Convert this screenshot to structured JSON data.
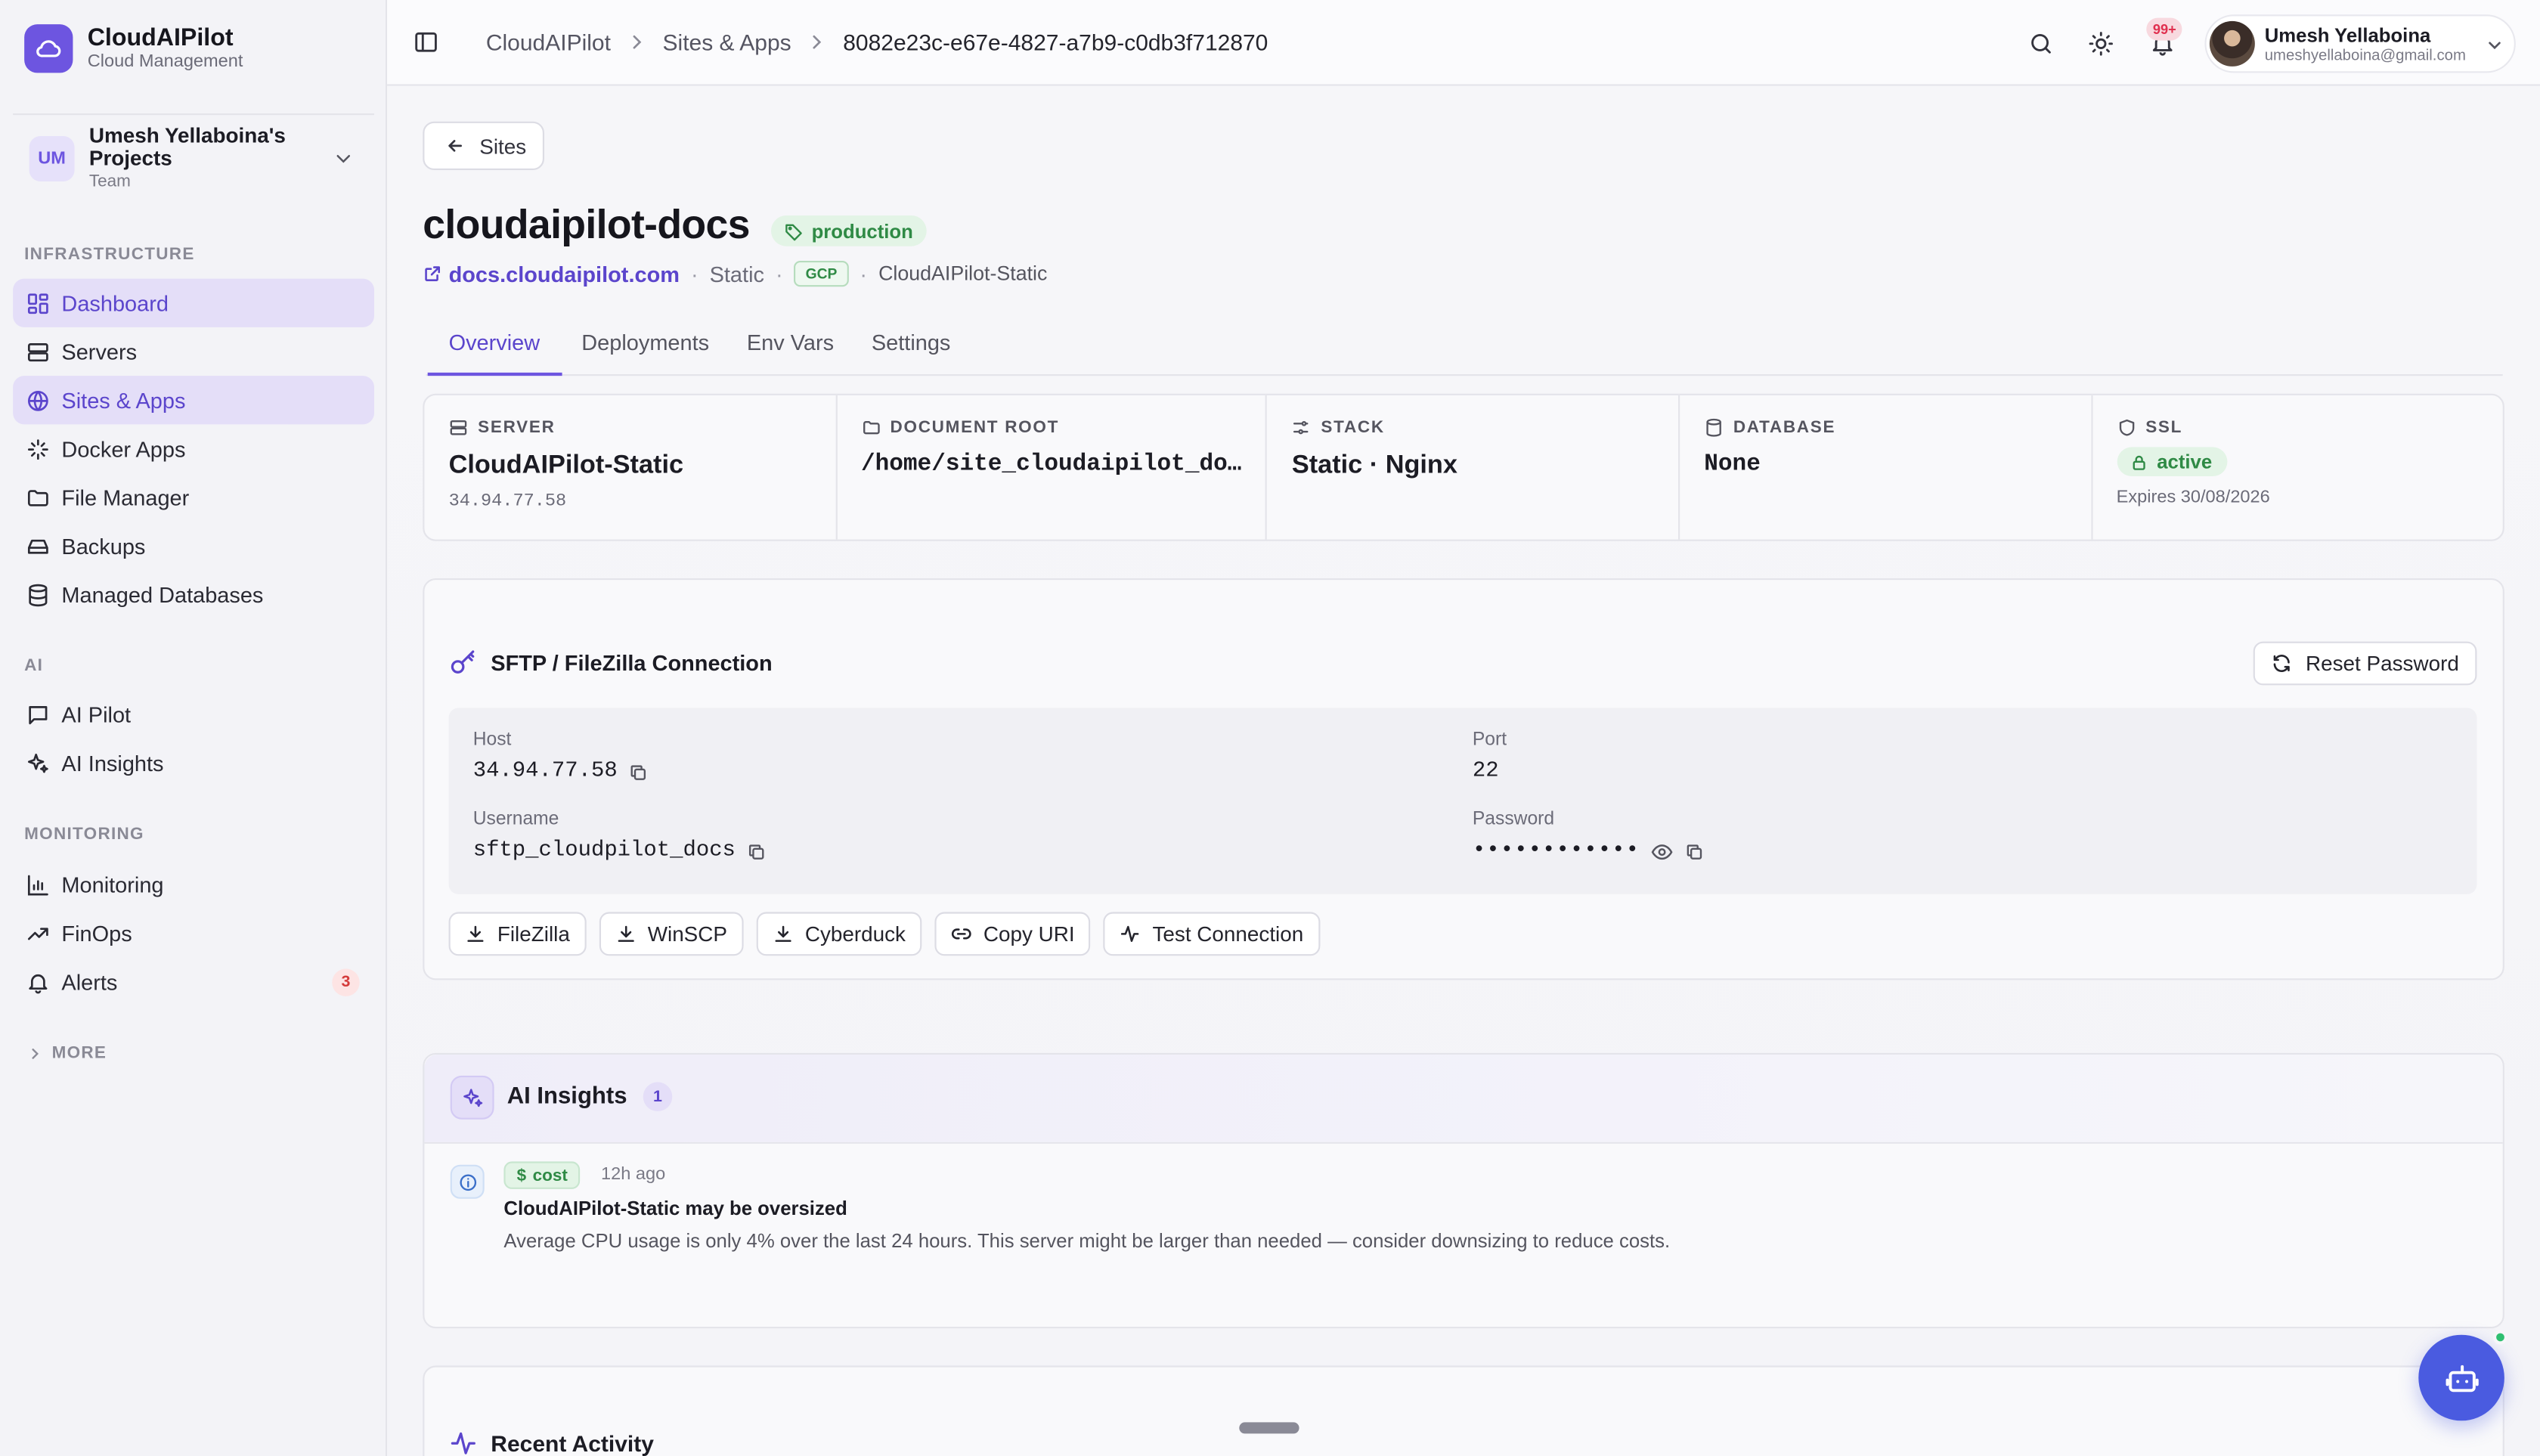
{
  "brand": {
    "name": "CloudAIPilot",
    "subtitle": "Cloud Management",
    "color": "#6d55e0"
  },
  "team": {
    "initials": "UM",
    "name": "Umesh Yellaboina's Projects",
    "role": "Team"
  },
  "nav": {
    "infrastructure_label": "INFRASTRUCTURE",
    "infrastructure": [
      {
        "label": "Dashboard",
        "icon": "dashboard-icon"
      },
      {
        "label": "Servers",
        "icon": "server-icon"
      },
      {
        "label": "Sites & Apps",
        "icon": "globe-icon"
      },
      {
        "label": "Docker Apps",
        "icon": "docker-icon"
      },
      {
        "label": "File Manager",
        "icon": "folder-icon"
      },
      {
        "label": "Backups",
        "icon": "hard-drive-icon"
      },
      {
        "label": "Managed Databases",
        "icon": "database-icon"
      }
    ],
    "ai_label": "AI",
    "ai": [
      {
        "label": "AI Pilot",
        "icon": "chat-icon"
      },
      {
        "label": "AI Insights",
        "icon": "sparkles-icon"
      }
    ],
    "monitoring_label": "MONITORING",
    "monitoring": [
      {
        "label": "Monitoring",
        "icon": "bar-chart-icon"
      },
      {
        "label": "FinOps",
        "icon": "trending-up-icon"
      },
      {
        "label": "Alerts",
        "icon": "bell-icon",
        "badge": "3"
      }
    ],
    "more_label": "MORE"
  },
  "breadcrumb": {
    "root": "CloudAIPilot",
    "section": "Sites & Apps",
    "current": "8082e23c-e67e-4827-a7b9-c0db3f712870"
  },
  "header": {
    "notifications_badge": "99+"
  },
  "user": {
    "name": "Umesh Yellaboina",
    "email": "umeshyellaboina@gmail.com"
  },
  "page": {
    "back_label": "Sites",
    "title": "cloudaipilot-docs",
    "env_badge": "production",
    "domain": "docs.cloudaipilot.com",
    "type": "Static",
    "provider": "GCP",
    "server": "CloudAIPilot-Static"
  },
  "tabs": [
    "Overview",
    "Deployments",
    "Env Vars",
    "Settings"
  ],
  "stats": {
    "server": {
      "label": "SERVER",
      "value": "CloudAIPilot-Static",
      "sub": "34.94.77.58"
    },
    "docroot": {
      "label": "DOCUMENT ROOT",
      "value": "/home/site_cloudaipilot_do…"
    },
    "stack": {
      "label": "STACK",
      "value": "Static · Nginx"
    },
    "database": {
      "label": "DATABASE",
      "value": "None"
    },
    "ssl": {
      "label": "SSL",
      "status": "active",
      "expires": "Expires 30/08/2026"
    }
  },
  "sftp": {
    "title": "SFTP / FileZilla Connection",
    "reset_label": "Reset Password",
    "host_label": "Host",
    "host": "34.94.77.58",
    "port_label": "Port",
    "port": "22",
    "username_label": "Username",
    "username": "sftp_cloudpilot_docs",
    "password_label": "Password",
    "password_mask": "••••••••••••",
    "actions": [
      "FileZilla",
      "WinSCP",
      "Cyberduck",
      "Copy URI",
      "Test Connection"
    ]
  },
  "insights": {
    "title": "AI Insights",
    "count": "1",
    "item": {
      "tag": "cost",
      "time": "12h ago",
      "headline": "CloudAIPilot-Static may be oversized",
      "description": "Average CPU usage is only 4% over the last 24 hours. This server might be larger than needed — consider downsizing to reduce costs."
    }
  },
  "recent": {
    "title": "Recent Activity"
  },
  "colors": {
    "accent": "#6d55e0",
    "success": "#2f8a45",
    "danger": "#d43b3b",
    "fab": "#4a5be0"
  }
}
